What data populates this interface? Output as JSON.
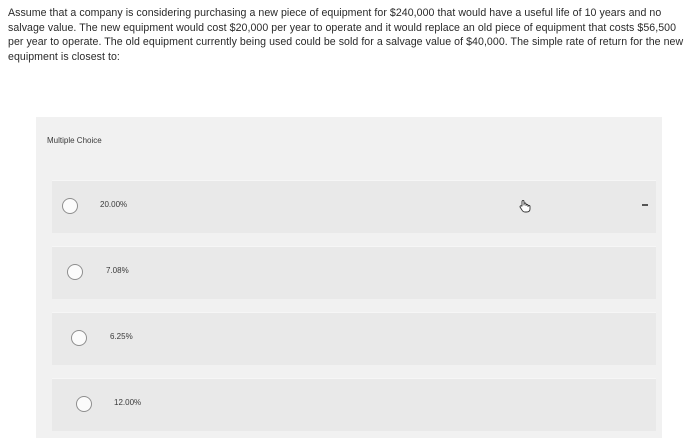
{
  "question": {
    "text": "Assume that a company is considering purchasing a new piece of equipment for $240,000 that would have a useful life of 10 years and no salvage value. The new equipment would cost $20,000 per year to operate and it would replace an old piece of equipment that costs $56,500 per year to operate. The old equipment currently being used could be sold for a salvage value of $40,000. The simple rate of return for the new equipment is closest to:"
  },
  "multiple_choice": {
    "label": "Multiple Choice",
    "options": [
      {
        "label": "20.00%"
      },
      {
        "label": "7.08%"
      },
      {
        "label": "6.25%"
      },
      {
        "label": "12.00%"
      }
    ]
  },
  "cursor": {
    "icon": "hand-pointer-icon"
  }
}
